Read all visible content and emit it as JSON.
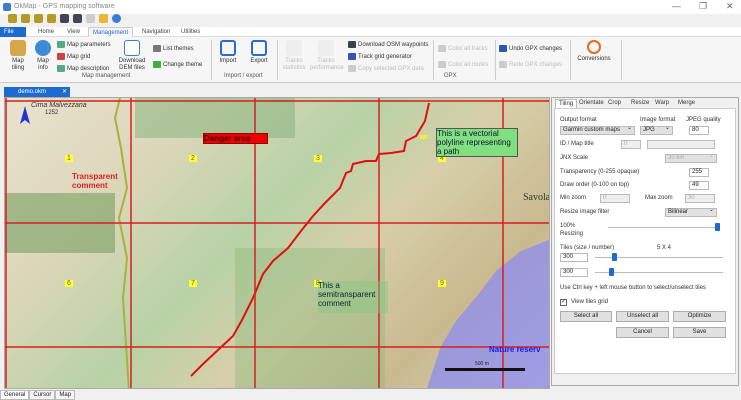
{
  "window": {
    "title": "OkMap - GPS mapping software",
    "minimize": "—",
    "restore": "❐",
    "close": "✕"
  },
  "ribbon_tabs": [
    "File",
    "Home",
    "View",
    "Management",
    "Navigation",
    "Utilities"
  ],
  "active_tab": "Management",
  "ribbon": {
    "map_tiling": "Map tiling",
    "map_info": "Map info",
    "map_parameters": "Map parameters",
    "map_grid": "Map grid",
    "map_description": "Map description",
    "download_dem": "Download DEM files",
    "list_themes": "List themes",
    "change_theme": "Change theme",
    "group_map_management": "Map management",
    "import": "Import",
    "export": "Export",
    "group_import_export": "Import / export",
    "tracks_statistics": "Tracks statistics",
    "tracks_performance": "Tracks performance",
    "download_osm": "Download OSM waypoints",
    "track_grid": "Track grid generator",
    "copy_gpx": "Copy selected GPX data",
    "color_tracks": "Color all tracks",
    "color_routes": "Color all routes",
    "group_gpx": "GPX",
    "undo_gpx": "Undo GPX changes",
    "redo_gpx": "Redo GPX changes",
    "conversions": "Conversions"
  },
  "document_tab": {
    "name": "demo.okm",
    "close": "✕"
  },
  "map": {
    "tiles_row1": [
      "1",
      "2",
      "3",
      "4"
    ],
    "tiles_row2": [
      "6",
      "7",
      "8",
      "9"
    ],
    "danger": "Danger area",
    "transparent": "Transparent comment",
    "polyline": "This is a vectorial polyline representing a path",
    "semitransparent": "This a semitransparent comment",
    "nature": "Nature reserv",
    "scale": "500 m",
    "place": "Cima Malvezzana",
    "elev": "1252",
    "town": "Savola",
    "path_color": "#e01010",
    "grid_color": "#d42020",
    "reserve_color": "#8c8cf0"
  },
  "panel": {
    "tabs": [
      "Tiling",
      "Orientate",
      "Crop",
      "Resize",
      "Warp",
      "Merge"
    ],
    "output_format_label": "Output format",
    "output_format": "Garmin custom maps",
    "image_format_label": "Image format",
    "image_format": "JPG",
    "jpeg_quality_label": "JPEG quality",
    "jpeg_quality": "80",
    "id_title_label": "ID / Map title",
    "id_value": "0",
    "jnx_label": "JNX Scale",
    "jnx_value": "20 km",
    "transparency_label": "Transparency (0-255 opaque)",
    "transparency": "255",
    "draw_order_label": "Draw order (0-100 on top)",
    "draw_order": "49",
    "min_zoom_label": "Min zoom",
    "min_zoom": "0",
    "max_zoom_label": "Max zoom",
    "max_zoom": "30",
    "resize_filter_label": "Resize image filter",
    "resize_filter": "Bilinear",
    "resizing_pct": "100%",
    "resizing_label": "Resizing",
    "resizing_value": 100,
    "tiles_label": "Tiles (size / number)",
    "tiles_count": "5  X  4",
    "tile_w": "300",
    "tile_h": "300",
    "hint": "Use Ctrl key + left mouse button to select/unselect tiles",
    "view_grid": "View tiles grid",
    "view_grid_checked": true,
    "select_all": "Select all",
    "unselect_all": "Unselect all",
    "optimize": "Optimize",
    "cancel": "Cancel",
    "save": "Save"
  },
  "bottom_tabs": [
    "General",
    "Cursor",
    "Map"
  ]
}
